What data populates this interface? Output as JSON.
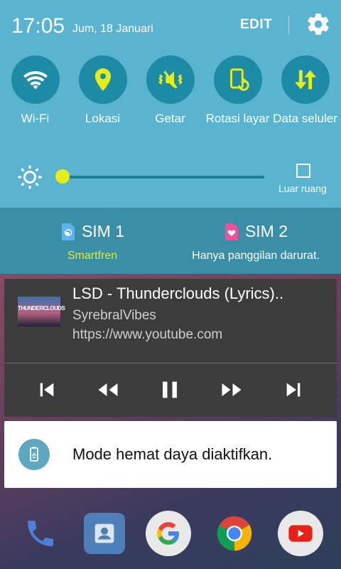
{
  "status": {
    "time": "17:05",
    "date": "Jum, 18 Januari",
    "edit_label": "EDIT"
  },
  "toggles": [
    {
      "icon": "wifi-icon",
      "label": "Wi-Fi"
    },
    {
      "icon": "location-icon",
      "label": "Lokasi"
    },
    {
      "icon": "vibrate-icon",
      "label": "Getar"
    },
    {
      "icon": "rotation-icon",
      "label": "Rotasi layar"
    },
    {
      "icon": "mobile-data-icon",
      "label": "Data seluler"
    }
  ],
  "brightness": {
    "level": 0.0,
    "outdoor_label": "Luar ruang",
    "outdoor_checked": false
  },
  "sim": [
    {
      "name": "SIM 1",
      "status": "Smartfren",
      "color": "#e6ee19"
    },
    {
      "name": "SIM 2",
      "status": "Hanya panggilan darurat.",
      "color": "#ffffff"
    }
  ],
  "media": {
    "title": "LSD - Thunderclouds (Lyrics)..",
    "artist": "SyrebralVibes",
    "url": "https://www.youtube.com",
    "art_text": "THUNDERCLOUDS",
    "controls": [
      "skip-previous-icon",
      "rewind-icon",
      "pause-icon",
      "fast-forward-icon",
      "skip-next-icon"
    ]
  },
  "notification": {
    "text": "Mode hemat daya diaktifkan."
  },
  "dock": [
    "phone-icon",
    "contacts-icon",
    "google-icon",
    "chrome-icon",
    "youtube-icon"
  ],
  "colors": {
    "panel": "#5ab4cf",
    "accent": "#e6ee19",
    "toggle_bg": "#1d8aa6",
    "sim_bg": "#3a8fa7"
  }
}
